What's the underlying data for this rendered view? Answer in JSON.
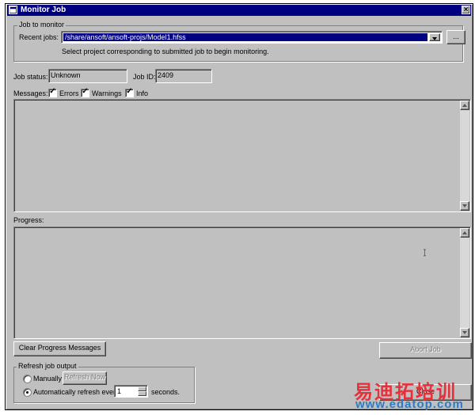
{
  "window": {
    "title": "Monitor Job",
    "close_glyph": "×"
  },
  "job_group": {
    "legend": "Job to monitor",
    "recent_jobs_label": "Recent jobs:",
    "recent_jobs_value": "/share/ansoft/ansoft-projs/Model1.hfss",
    "browse_label": "...",
    "hint": "Select project corresponding to submitted job to begin monitoring."
  },
  "status": {
    "job_status_label": "Job status:",
    "job_status_value": "Unknown",
    "job_id_label": "Job ID:",
    "job_id_value": "2409"
  },
  "messages": {
    "label": "Messages:",
    "filters": [
      {
        "label": "Errors",
        "checked": true
      },
      {
        "label": "Warnings",
        "checked": true
      },
      {
        "label": "Info",
        "checked": true
      }
    ],
    "check_glyph": "✓"
  },
  "progress": {
    "label": "Progress:"
  },
  "buttons": {
    "clear_progress": "Clear Progress Messages",
    "abort_job": "Abort Job",
    "close": "Close"
  },
  "refresh": {
    "legend": "Refresh job output",
    "manually_label": "Manually",
    "refresh_now_label": "Refresh Now",
    "auto_label": "Automatically refresh every",
    "interval_value": "1",
    "seconds_label": "seconds."
  },
  "watermark": {
    "chinese_text": "易迪拓培训",
    "url_text": "www.edatop.com"
  },
  "colors": {
    "face": "#c0c0c0",
    "title_bar": "#000080",
    "selection": "#000080",
    "watermark_red": "#e8303a",
    "watermark_blue": "#2d7bc4"
  }
}
